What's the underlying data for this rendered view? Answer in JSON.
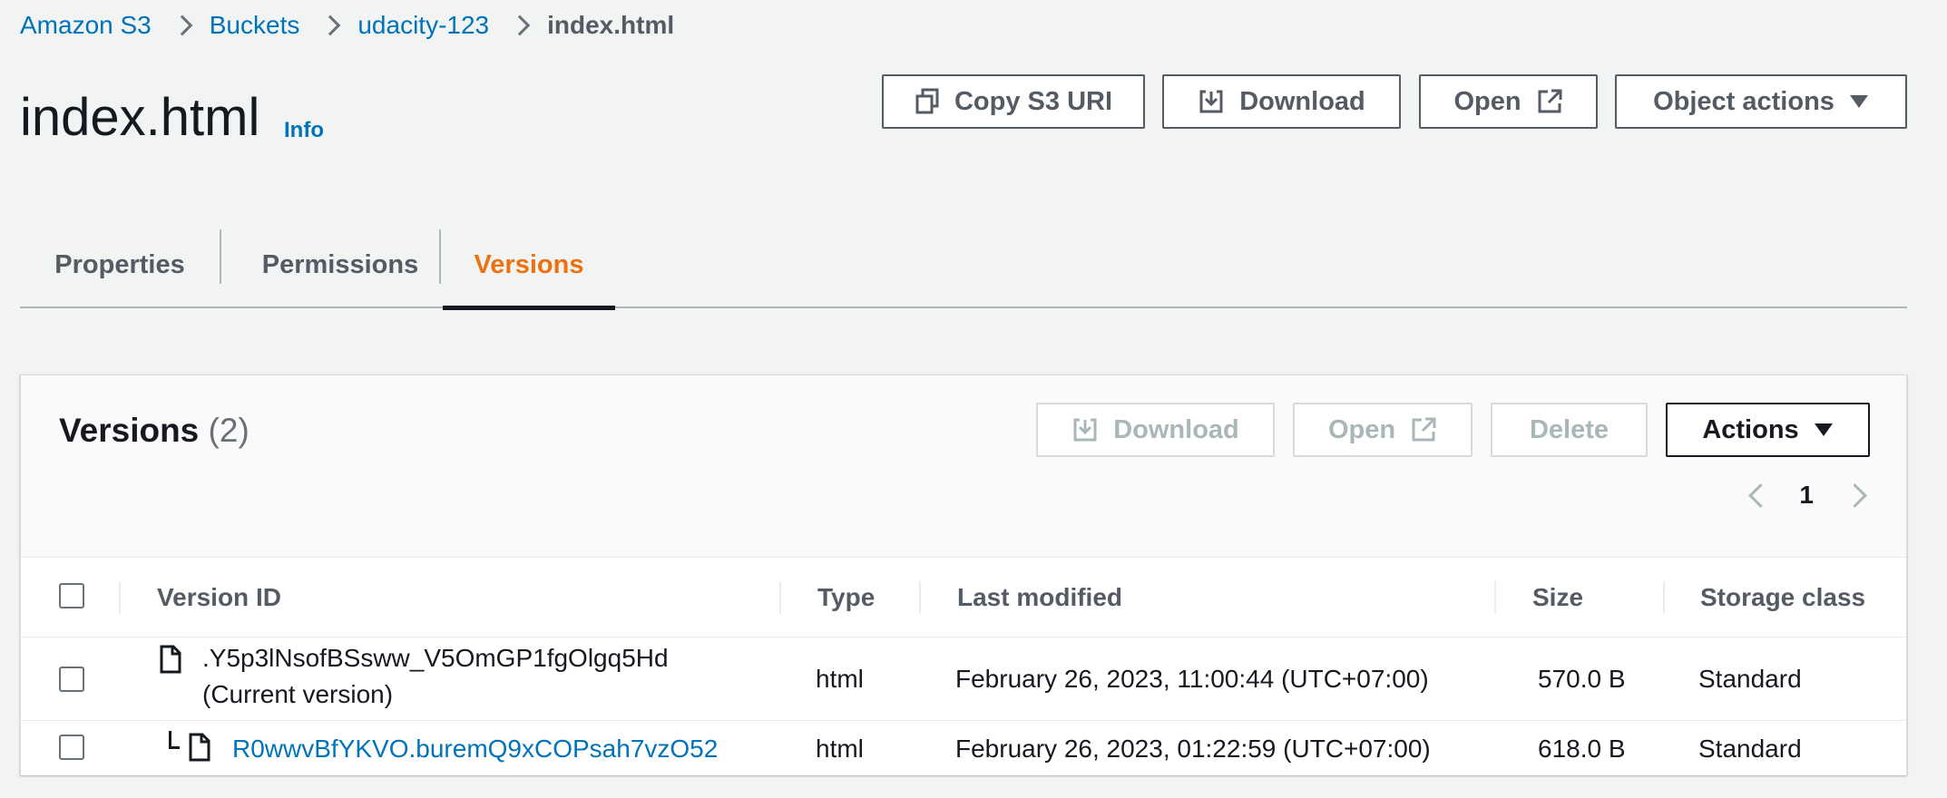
{
  "breadcrumb": {
    "items": [
      "Amazon S3",
      "Buckets",
      "udacity-123"
    ],
    "current": "index.html"
  },
  "page": {
    "title": "index.html",
    "info": "Info"
  },
  "header_buttons": {
    "copy_uri": "Copy S3 URI",
    "download": "Download",
    "open": "Open",
    "object_actions": "Object actions"
  },
  "tabs": [
    {
      "label": "Properties",
      "active": false
    },
    {
      "label": "Permissions",
      "active": false
    },
    {
      "label": "Versions",
      "active": true
    }
  ],
  "versions_panel": {
    "title": "Versions",
    "count": "(2)",
    "buttons": {
      "download": "Download",
      "open": "Open",
      "delete": "Delete",
      "actions": "Actions"
    },
    "page": "1"
  },
  "table": {
    "columns": [
      "Version ID",
      "Type",
      "Last modified",
      "Size",
      "Storage class"
    ],
    "rows": [
      {
        "version_id": ".Y5p3lNsofBSsww_V5OmGP1fgOlgq5Hd",
        "version_note": "(Current version)",
        "type": "html",
        "last_modified": "February 26, 2023, 11:00:44 (UTC+07:00)",
        "size": "570.0 B",
        "storage_class": "Standard"
      },
      {
        "version_id": "R0wwvBfYKVO.buremQ9xCOPsah7vzO52",
        "type": "html",
        "last_modified": "February 26, 2023, 01:22:59 (UTC+07:00)",
        "size": "618.0 B",
        "storage_class": "Standard"
      }
    ]
  },
  "colors": {
    "link": "#0073bb",
    "active_tab": "#ec7211",
    "background": "#f2f3f3",
    "border": "#545b64",
    "disabled": "#aab7b8"
  }
}
